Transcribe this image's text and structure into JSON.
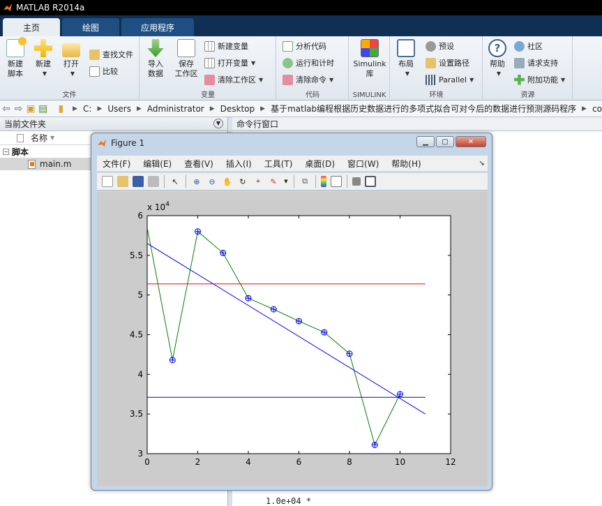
{
  "app": {
    "title": "MATLAB R2014a"
  },
  "tabs": [
    {
      "label": "主页",
      "active": true
    },
    {
      "label": "绘图",
      "active": false
    },
    {
      "label": "应用程序",
      "active": false
    }
  ],
  "ribbon": {
    "file": {
      "label": "文件",
      "new_script": "新建\n脚本",
      "new": "新建",
      "open": "打开",
      "find_files": "查找文件",
      "compare": "比较"
    },
    "variable": {
      "label": "变量",
      "import": "导入\n数据",
      "save_ws": "保存\n工作区",
      "new_var": "新建变量",
      "open_var": "打开变量",
      "clear_ws": "清除工作区"
    },
    "code": {
      "label": "代码",
      "analyze": "分析代码",
      "run_time": "运行和计时",
      "clear_cmd": "清除命令"
    },
    "simulink": {
      "label": "SIMULINK",
      "lib": "Simulink\n库"
    },
    "env": {
      "label": "环境",
      "layout": "布局",
      "prefs": "预设",
      "set_path": "设置路径",
      "parallel": "Parallel"
    },
    "resources": {
      "label": "资源",
      "help": "帮助",
      "community": "社区",
      "support": "请求支持",
      "addons": "附加功能"
    }
  },
  "address": {
    "crumbs": [
      "C:",
      "Users",
      "Administrator",
      "Desktop",
      "基于matlab编程根据历史数据进行的多项式拟合可对今后的数据进行预测源码程序",
      "co"
    ]
  },
  "left_panel": {
    "title": "当前文件夹",
    "column_name": "名称",
    "folder": "脚本",
    "file": "main.m"
  },
  "right_panel": {
    "title": "命令行窗口",
    "output": "1.0e+04 *"
  },
  "figure": {
    "title": "Figure 1",
    "menu": [
      "文件(F)",
      "编辑(E)",
      "查看(V)",
      "插入(I)",
      "工具(T)",
      "桌面(D)",
      "窗口(W)",
      "帮助(H)"
    ]
  },
  "chart_data": {
    "type": "line",
    "title": "",
    "xlabel": "",
    "ylabel": "",
    "y_multiplier_label": "x 10",
    "y_multiplier_exp": "4",
    "xlim": [
      0,
      12
    ],
    "ylim": [
      3,
      6
    ],
    "xticks": [
      0,
      2,
      4,
      6,
      8,
      10,
      12
    ],
    "yticks": [
      3,
      3.5,
      4,
      4.5,
      5,
      5.5,
      6
    ],
    "ytick_labels": [
      "3",
      "3.5",
      "4",
      "4.5",
      "5",
      "5.5",
      "6"
    ],
    "grid": false,
    "series": [
      {
        "color": "#008000",
        "marker": "circle-plus",
        "marker_from": 1,
        "x": [
          0,
          1,
          2,
          3,
          4,
          5,
          6,
          7,
          8,
          9,
          10
        ],
        "y": [
          5.85,
          4.18,
          5.8,
          5.53,
          4.96,
          4.82,
          4.67,
          4.53,
          4.26,
          3.11,
          3.75
        ]
      },
      {
        "color": "#0000ff",
        "marker": "none",
        "x": [
          0,
          11
        ],
        "y": [
          5.65,
          3.5
        ]
      },
      {
        "color": "#ff0000",
        "marker": "none",
        "x": [
          0,
          11
        ],
        "y": [
          5.14,
          5.14
        ]
      },
      {
        "color": "#0000cc",
        "marker": "none",
        "x": [
          0,
          11
        ],
        "y": [
          3.71,
          3.71
        ]
      }
    ]
  }
}
